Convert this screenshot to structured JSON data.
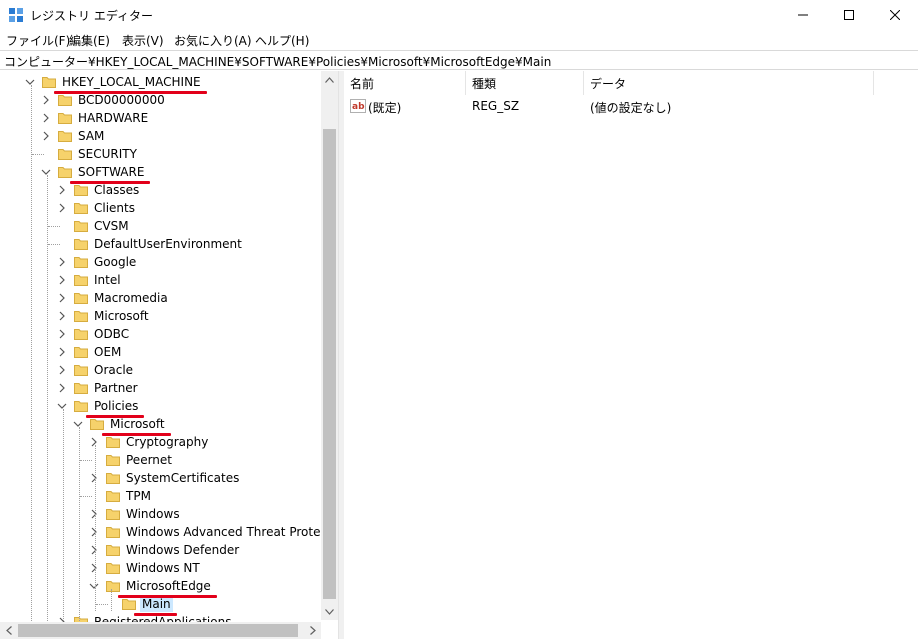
{
  "window": {
    "title": "レジストリ エディター",
    "colors": {
      "underline": "#e2001a",
      "selection": "#cce8ff",
      "folder": "#f6d26b"
    }
  },
  "menu": {
    "items": [
      "ファイル(F)",
      "編集(E)",
      "表示(V)",
      "お気に入り(A)",
      "ヘルプ(H)"
    ]
  },
  "address": {
    "path": "コンピューター¥HKEY_LOCAL_MACHINE¥SOFTWARE¥Policies¥Microsoft¥MicrosoftEdge¥Main"
  },
  "tree": {
    "nodes": [
      {
        "label": "HKEY_LOCAL_MACHINE",
        "expanded": true,
        "underlined": true
      },
      {
        "label": "BCD00000000"
      },
      {
        "label": "HARDWARE"
      },
      {
        "label": "SAM"
      },
      {
        "label": "SECURITY"
      },
      {
        "label": "SOFTWARE",
        "expanded": true,
        "underlined": true
      },
      {
        "label": "Classes"
      },
      {
        "label": "Clients"
      },
      {
        "label": "CVSM"
      },
      {
        "label": "DefaultUserEnvironment"
      },
      {
        "label": "Google"
      },
      {
        "label": "Intel"
      },
      {
        "label": "Macromedia"
      },
      {
        "label": "Microsoft"
      },
      {
        "label": "ODBC"
      },
      {
        "label": "OEM"
      },
      {
        "label": "Oracle"
      },
      {
        "label": "Partner"
      },
      {
        "label": "Policies",
        "expanded": true,
        "underlined": true
      },
      {
        "label": "Microsoft",
        "expanded": true,
        "underlined": true
      },
      {
        "label": "Cryptography"
      },
      {
        "label": "Peernet"
      },
      {
        "label": "SystemCertificates"
      },
      {
        "label": "TPM"
      },
      {
        "label": "Windows"
      },
      {
        "label": "Windows Advanced Threat Protection"
      },
      {
        "label": "Windows Defender"
      },
      {
        "label": "Windows NT"
      },
      {
        "label": "MicrosoftEdge",
        "expanded": true,
        "underlined": true
      },
      {
        "label": "Main",
        "selected": true,
        "underlined": true
      },
      {
        "label": "RegisteredApplications"
      }
    ]
  },
  "list": {
    "headers": {
      "name": "名前",
      "type": "種類",
      "data": "データ"
    },
    "rows": [
      {
        "icon": "string-value-icon",
        "name": "(既定)",
        "type": "REG_SZ",
        "data": "(値の設定なし)"
      }
    ]
  }
}
